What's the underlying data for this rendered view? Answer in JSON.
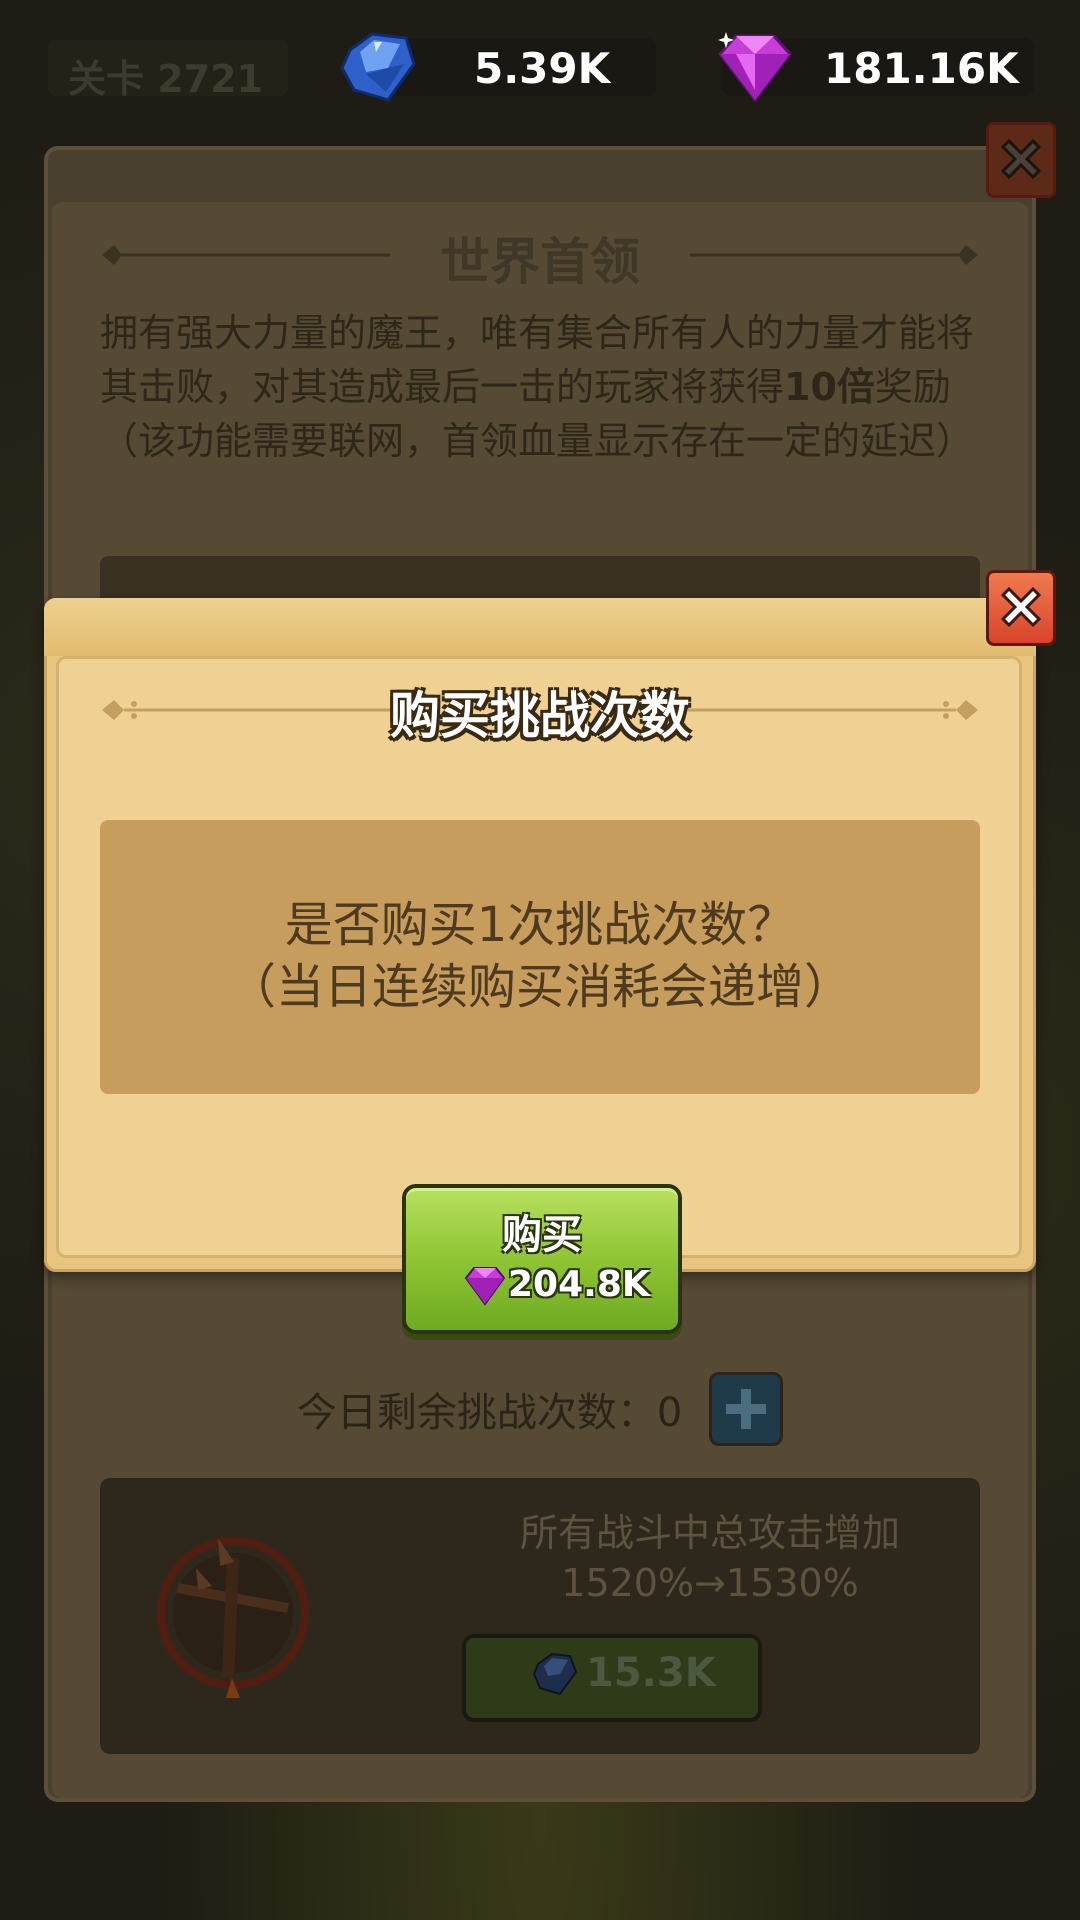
{
  "topbar": {
    "level_label": "关卡 2721",
    "blue_gem_value": "5.39K",
    "purple_gem_value": "181.16K",
    "blue_gem_icon": "blue-crystal-icon",
    "purple_gem_icon": "purple-diamond-icon"
  },
  "world_boss": {
    "title": "世界首领",
    "description_prefix": "拥有强大力量的魔王，唯有集合所有人的力量才能将其击败，对其造成最后一击的玩家将获得",
    "description_bold": "10倍",
    "description_suffix": "奖励（该功能需要联网，首领血量显示存在一定的延迟）",
    "remaining_label": "今日剩余挑战次数：0",
    "upgrade_line1": "所有战斗中总攻击增加",
    "upgrade_line2": "1520%→1530%",
    "upgrade_cost": "15.3K"
  },
  "modal": {
    "title": "购买挑战次数",
    "message_line1": "是否购买1次挑战次数？",
    "message_line2": "（当日连续购买消耗会递增）",
    "buy_label": "购买",
    "buy_price": "204.8K"
  },
  "colors": {
    "accent_green": "#8fc534",
    "close_red": "#e2542e",
    "parchment": "#efd193"
  }
}
